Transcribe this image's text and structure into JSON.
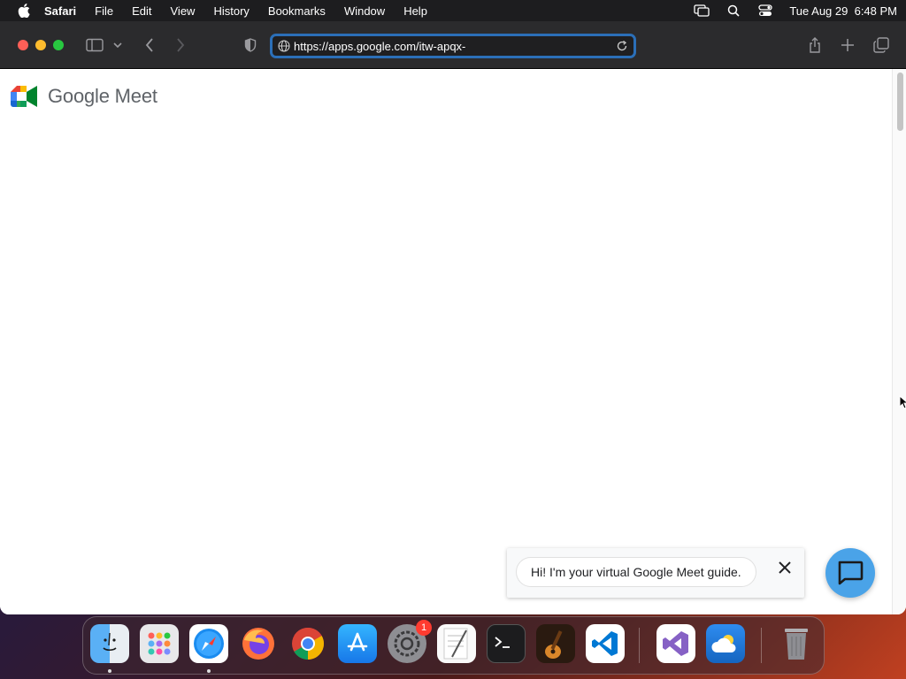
{
  "menubar": {
    "app_name": "Safari",
    "items": [
      "File",
      "Edit",
      "View",
      "History",
      "Bookmarks",
      "Window",
      "Help"
    ],
    "datetime": "Tue Aug 29  6:48 PM"
  },
  "browser": {
    "url": "https://apps.google.com/itw-apqx-"
  },
  "page": {
    "logo_text": "Google Meet",
    "guide_message": "Hi! I'm your virtual Google Meet guide."
  },
  "dock": {
    "apps": [
      "Finder",
      "Launchpad",
      "Safari",
      "Firefox",
      "Chrome",
      "App Store",
      "System Settings",
      "TextEdit",
      "Terminal",
      "GarageBand",
      "Visual Studio Code",
      "Visual Studio",
      "Weather",
      "Trash"
    ],
    "settings_badge": "1"
  },
  "colors": {
    "url_focus": "#2b6fb8",
    "chat_fab": "#4aa3e8"
  }
}
